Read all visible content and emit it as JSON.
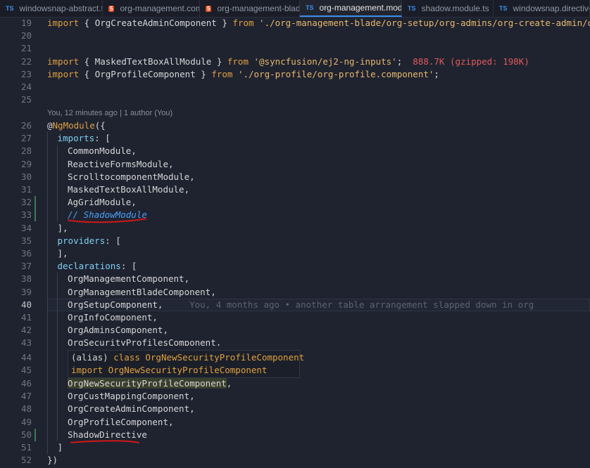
{
  "tabs": [
    {
      "label": "windowsnap-abstract.ts",
      "icon": "TS",
      "icon_name": "typescript-icon",
      "active": false
    },
    {
      "label": "org-management.component.html",
      "icon": "5",
      "icon_name": "html5-icon",
      "active": false
    },
    {
      "label": "org-management-blade.component.html",
      "icon": "5",
      "icon_name": "html5-icon",
      "active": false
    },
    {
      "label": "org-management.module.ts",
      "icon": "TS",
      "icon_name": "typescript-icon",
      "active": true
    },
    {
      "label": "shadow.module.ts",
      "icon": "TS",
      "icon_name": "typescript-icon",
      "active": false
    },
    {
      "label": "windowsnap.directive.ts",
      "icon": "TS",
      "icon_name": "typescript-icon",
      "active": false
    }
  ],
  "gutter": {
    "l19": "19",
    "l20": "20",
    "l21": "21",
    "l22": "22",
    "l23": "23",
    "l24": "24",
    "l25": "25",
    "l26": "26",
    "l27": "27",
    "l28": "28",
    "l29": "29",
    "l30": "30",
    "l31": "31",
    "l32": "32",
    "l33": "33",
    "l34": "34",
    "l35": "35",
    "l36": "36",
    "l37": "37",
    "l38": "38",
    "l39": "39",
    "l40": "40",
    "l41": "41",
    "l42": "42",
    "l43": "43",
    "l44": "44",
    "l45": "45",
    "l46": "46",
    "l47": "47",
    "l48": "48",
    "l49": "49",
    "l50": "50",
    "l51": "51",
    "l52": "52"
  },
  "code": {
    "l19_import": "import",
    "l19_body": " { OrgCreateAdminComponent } ",
    "l19_from": "from",
    "l19_path": " './org-management-blade/org-setup/org-admins/org-create-admin/org",
    "l22_import": "import",
    "l22_body": " { MaskedTextBoxAllModule } ",
    "l22_from": "from",
    "l22_path": " '@syncfusion/ej2-ng-inputs'",
    "l22_semi": ";",
    "l22_size": "  888.7K (gzipped: 198K)",
    "l23_import": "import",
    "l23_body": " { OrgProfileComponent } ",
    "l23_from": "from",
    "l23_path": " './org-profile/org-profile.component'",
    "l23_semi": ";",
    "codelens": "You, 12 minutes ago | 1 author (You)",
    "l26_at": "@",
    "l26_dec": "NgModule",
    "l26_rest": "({",
    "l27_prop": "imports",
    "l27_rest": ": [",
    "l28": "CommonModule,",
    "l29": "ReactiveFormsModule,",
    "l30": "ScrolltocomponentModule,",
    "l31": "MaskedTextBoxAllModule,",
    "l32": "AgGridModule,",
    "l33": "// ShadowModule",
    "l34": "],",
    "l35_prop": "providers",
    "l35_rest": ": [",
    "l36": "],",
    "l37_prop": "declarations",
    "l37_rest": ": [",
    "l38": "OrgManagementComponent,",
    "l39": "OrgManagementBladeComponent,",
    "l40": "OrgSetupComponent,",
    "l40_blame": "     You, 4 months ago • another table arrangement slapped down in org",
    "l41": "OrgInfoComponent,",
    "l42": "OrgAdminsComponent,",
    "l43": "OrgSecurityProfilesComponent,",
    "l46_word": "OrgNewSecurityProfileComponent",
    "l46_rest": ",",
    "l47": "OrgCustMappingComponent,",
    "l48": "OrgCreateAdminComponent,",
    "l49": "OrgProfileComponent,",
    "l50": "ShadowDirective",
    "l51": "]",
    "l52": "})"
  },
  "hover": {
    "alias": "(alias) ",
    "class_kw": "class",
    "class_name": " OrgNewSecurityProfileComponent",
    "import_kw": "import",
    "import_name": " OrgNewSecurityProfileComponent"
  },
  "colors": {
    "background": "#1f2330",
    "keyword": "#e0a040",
    "comment": "#4a9ff5",
    "bundle_size": "#e05a5a",
    "ink_annotation": "#d01818",
    "tab_active_border": "#3b8eea"
  }
}
